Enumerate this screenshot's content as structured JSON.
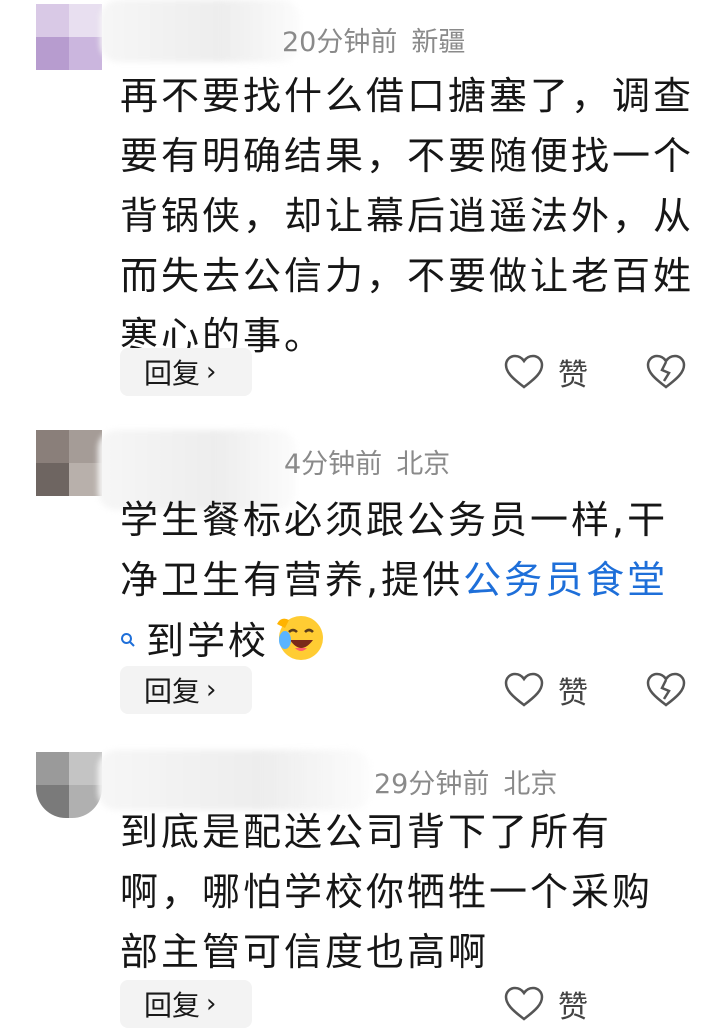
{
  "comments": [
    {
      "time": "20分钟前",
      "location": "新疆",
      "text": "再不要找什么借口搪塞了，调查要有明确结果，不要随便找一个背锅侠，却让幕后逍遥法外，从而失去公信力，不要做让老百姓寒心的事。",
      "reply_label": "回复",
      "like_label": "赞"
    },
    {
      "time": "4分钟前",
      "location": "北京",
      "text_before": "学生餐标必须跟公务员一样,干净卫生有营养,提供",
      "link_text": "公务员食堂",
      "text_after": "到学校",
      "reply_label": "回复",
      "like_label": "赞"
    },
    {
      "time": "29分钟前",
      "location": "北京",
      "text": "到底是配送公司背下了所有啊，哪怕学校你牺牲一个采购部主管可信度也高啊",
      "reply_label": "回复",
      "like_label": "赞"
    }
  ],
  "colors": {
    "link": "#1e6fd9",
    "meta": "#8a8a8a",
    "button_bg": "#f3f3f3"
  },
  "icons": [
    "chevron-right-icon",
    "heart-icon",
    "broken-heart-icon",
    "search-icon",
    "laughing-crying-emoji-icon"
  ]
}
